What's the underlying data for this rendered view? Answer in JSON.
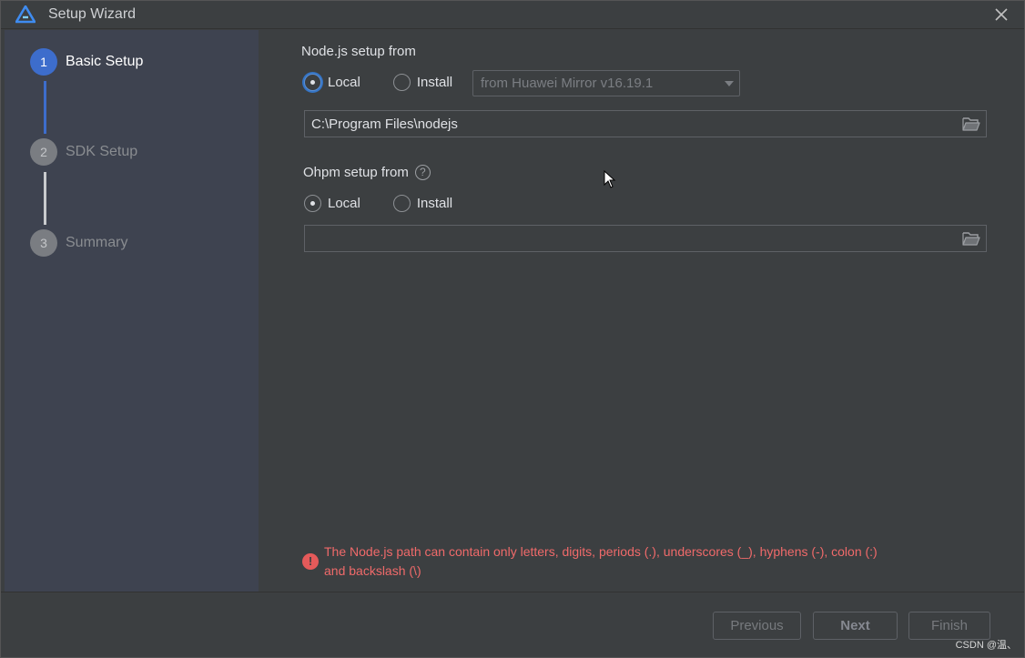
{
  "window": {
    "title": "Setup Wizard"
  },
  "steps": [
    {
      "number": "1",
      "label": "Basic Setup",
      "state": "active"
    },
    {
      "number": "2",
      "label": "SDK Setup",
      "state": "inactive"
    },
    {
      "number": "3",
      "label": "Summary",
      "state": "inactive"
    }
  ],
  "nodejs": {
    "title": "Node.js setup from",
    "option_local": "Local",
    "option_install": "Install",
    "selected": "Local",
    "mirror_select": "from Huawei Mirror v16.19.1",
    "path_value": "C:\\Program Files\\nodejs"
  },
  "ohpm": {
    "title": "Ohpm setup from",
    "help": "?",
    "option_local": "Local",
    "option_install": "Install",
    "selected": "Local",
    "path_value": ""
  },
  "error": {
    "icon": "!",
    "line1": "The Node.js path can contain only letters, digits, periods (.), underscores (_), hyphens (-), colon (:)",
    "line2": "and backslash (\\)"
  },
  "footer": {
    "previous_label": "Previous",
    "next_label": "Next",
    "finish_label": "Finish"
  },
  "watermark": "CSDN @温、",
  "colors": {
    "accent": "#3d6dcc",
    "error": "#f06a6a",
    "background": "#3c3f41",
    "sidebar": "#3e4350"
  }
}
